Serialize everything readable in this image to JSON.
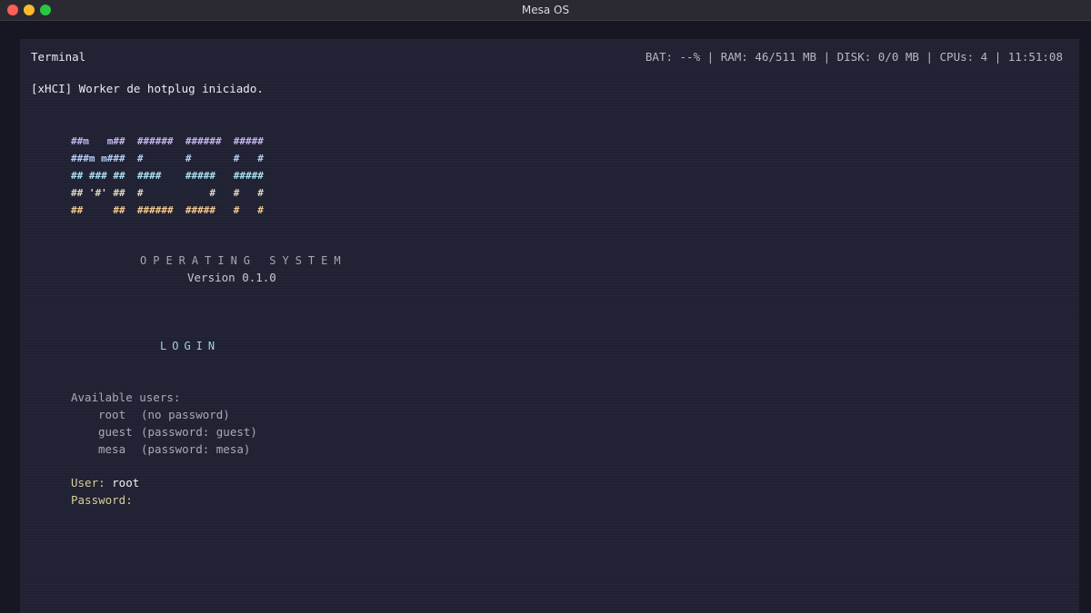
{
  "window": {
    "title": "Mesa OS"
  },
  "terminal": {
    "label": "Terminal",
    "status": {
      "battery": "BAT: --%",
      "ram": "RAM: 46/511 MB",
      "disk": "DISK: 0/0 MB",
      "cpus": "CPUs: 4",
      "time": "11:51:08",
      "separator": " | "
    },
    "boot_message": "[xHCI] Worker de hotplug iniciado.",
    "logo": {
      "rows": [
        {
          "text": "##m   m##  ######  ######  #####",
          "color": "#c3b4ee"
        },
        {
          "text": "###m m###  #       #       #   #",
          "color": "#b2cdf3"
        },
        {
          "text": "## ### ##  ####    #####   #####",
          "color": "#a8dff0"
        },
        {
          "text": "## '#' ##  #           #   #   #",
          "color": "#ddd8bd"
        },
        {
          "text": "##     ##  ######  #####   #   #",
          "color": "#f4c890"
        }
      ]
    },
    "subtitle": "OPERATING SYSTEM",
    "version": "Version 0.1.0",
    "login_heading": "LOGIN",
    "users_heading": "Available users:",
    "users": [
      {
        "name": "root",
        "note": "(no password)"
      },
      {
        "name": "guest",
        "note": "(password: guest)"
      },
      {
        "name": "mesa",
        "note": "(password: mesa)"
      }
    ],
    "prompt": {
      "user_label": "User: ",
      "user_value": "root",
      "password_label": "Password:",
      "password_value": ""
    }
  }
}
